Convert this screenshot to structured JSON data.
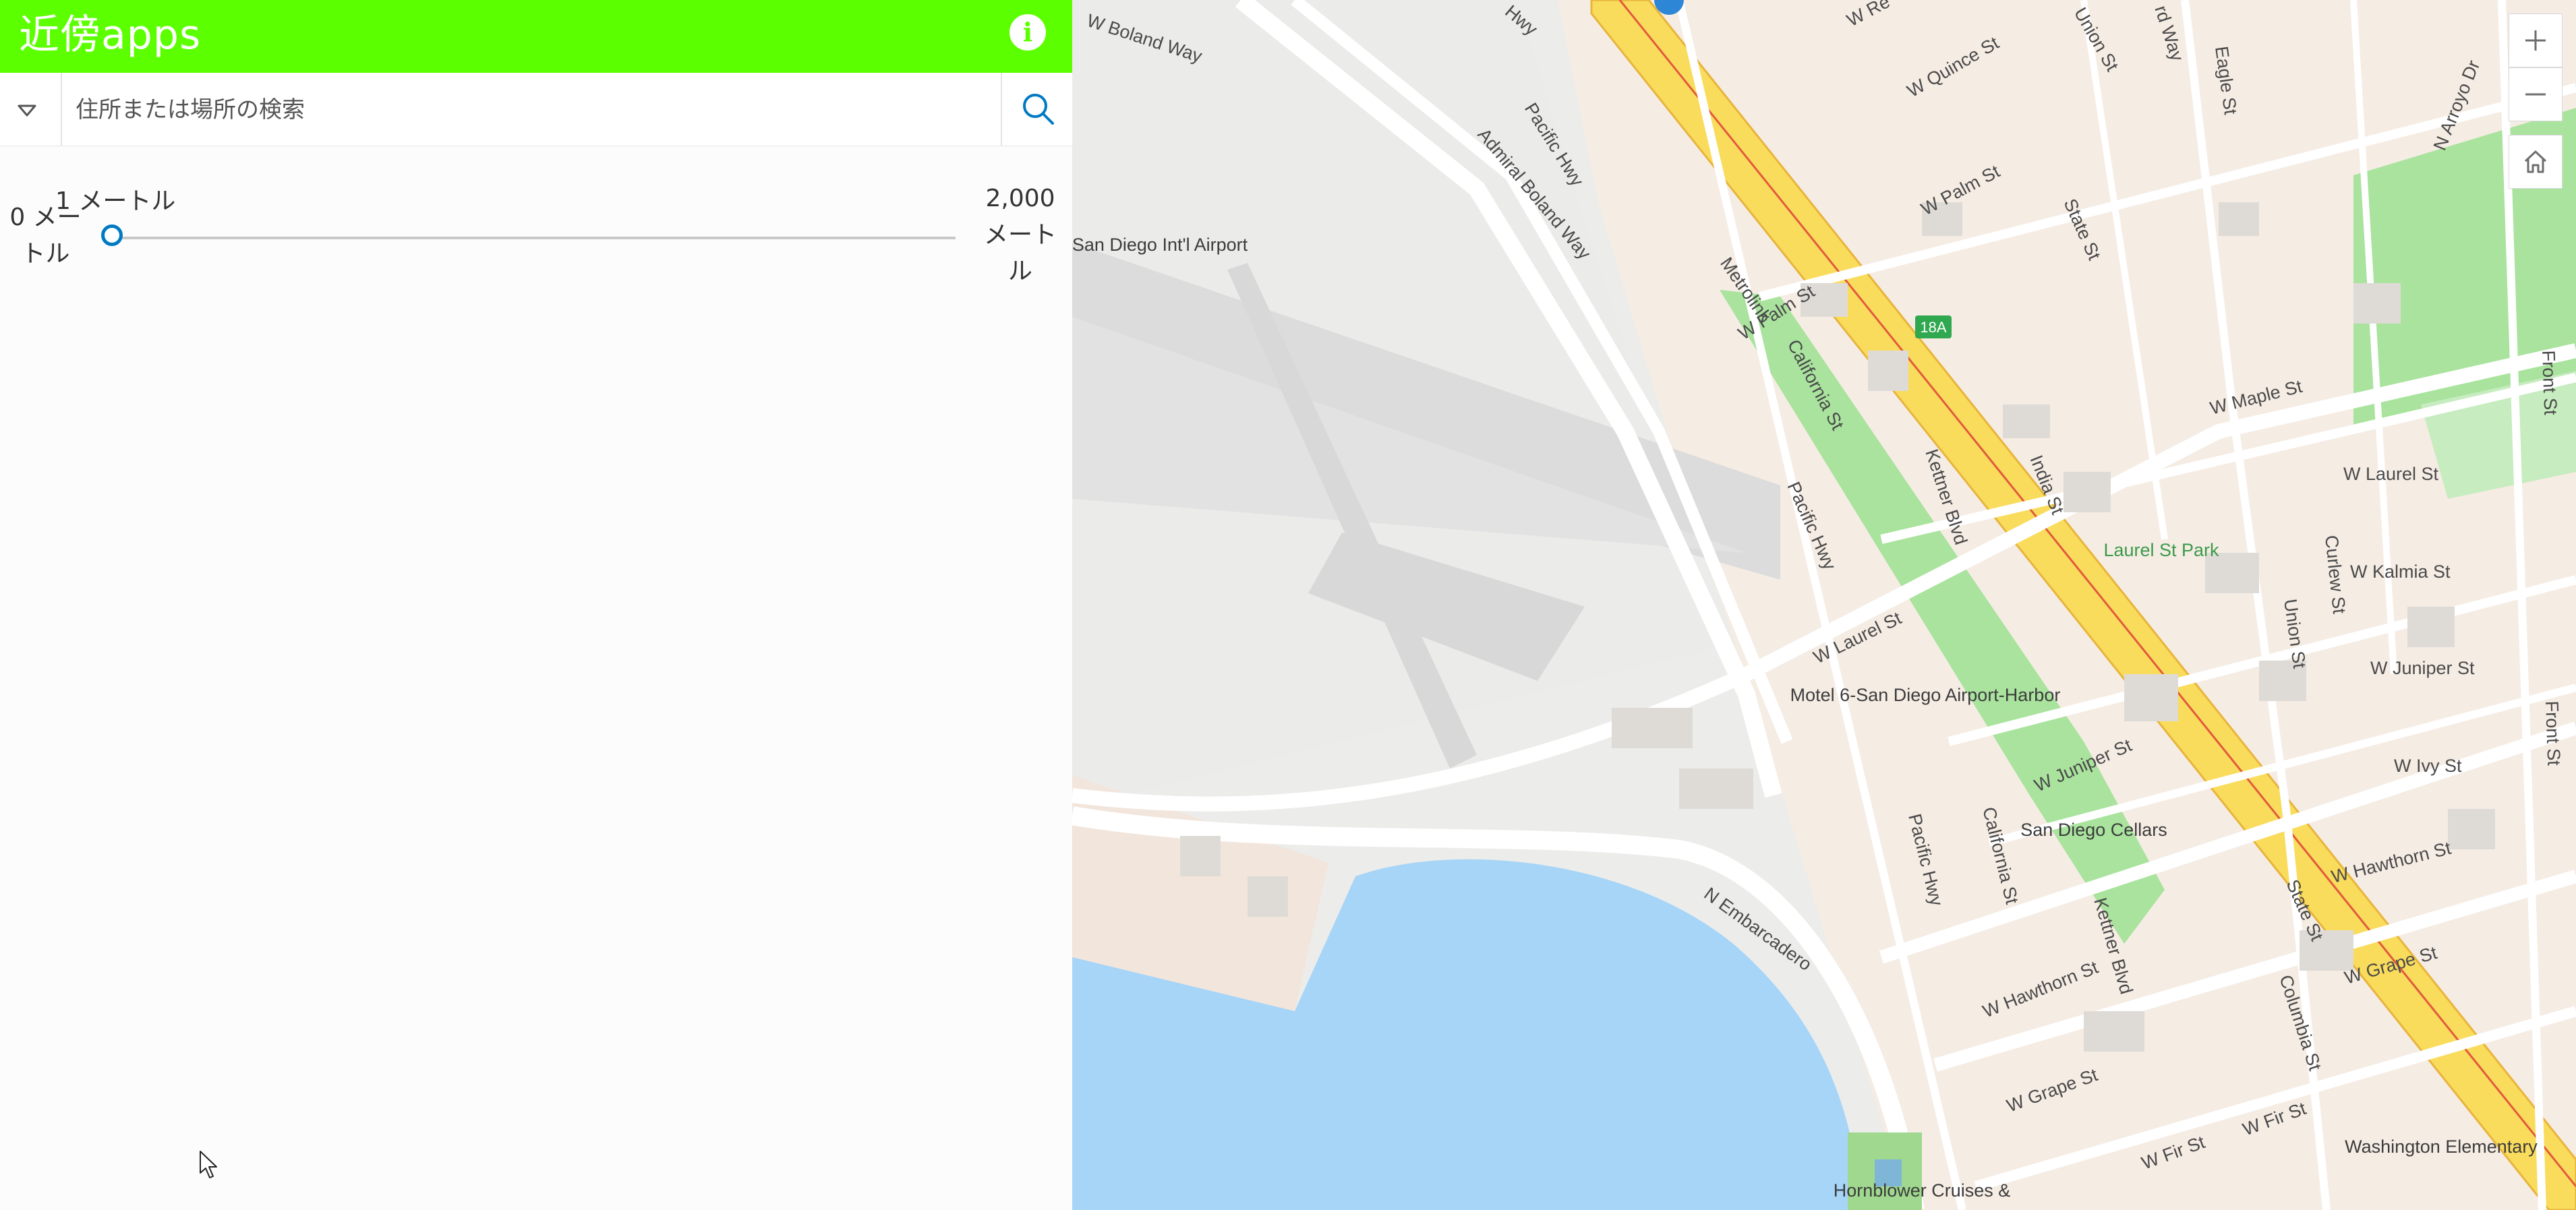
{
  "header": {
    "title": "近傍apps",
    "info_icon": "info-icon",
    "color": "#5cff00"
  },
  "search": {
    "placeholder": "住所または場所の検索",
    "toggle_icon": "triangle-down-icon",
    "search_icon": "search-icon"
  },
  "slider": {
    "min_label": "0 メートル",
    "current_label": "1 メートル",
    "max_label": "2,000 メートル",
    "min": 0,
    "max": 2000,
    "value": 1,
    "accent": "#007ac2"
  },
  "map": {
    "controls": {
      "zoom_in_icon": "plus-icon",
      "zoom_out_icon": "minus-icon",
      "home_icon": "home-icon"
    },
    "highway_shield": "18A",
    "places": {
      "airport": "San Diego Int'l Airport",
      "park": "Laurel St Park",
      "motel": "Motel 6-San Diego Airport-Harbor",
      "cellars": "San Diego Cellars",
      "school": "Washington Elementary",
      "hornblower": "Hornblower Cruises &",
      "metrolink": "Metrolink"
    },
    "streets": {
      "boland": "W Boland Way",
      "pacific1": "Pacific Hwy",
      "admiral": "Admiral Boland Way",
      "pacific_hwy_top": "Hwy",
      "pacific2": "Pacific Hwy",
      "pacific3": "Pacific Hwy",
      "w_palm_left": "W Palm St",
      "california1": "California St",
      "kettner1": "Kettner Blvd",
      "india": "India St",
      "w_laurel_left": "W Laurel St",
      "n_embarcadero": "N Embarcadero",
      "w_juniper_mid": "W Juniper St",
      "california2": "California St",
      "kettner2": "Kettner Blvd",
      "w_hawthorn_mid": "W Hawthorn St",
      "w_grape_mid": "W Grape St",
      "w_fir_1": "W Fir St",
      "w_fir_2": "W Fir St",
      "columbia": "Columbia St",
      "state1": "State St",
      "state2": "State St",
      "w_grape_right": "W Grape St",
      "w_hawthorn_right": "W Hawthorn St",
      "w_ivy": "W Ivy St",
      "w_juniper_right": "W Juniper St",
      "w_kalmia": "W Kalmia St",
      "w_laurel_right": "W Laurel St",
      "w_maple": "W Maple St",
      "union1": "Union St",
      "union2": "Union St",
      "curlew": "Curlew St",
      "front1": "Front St",
      "front2": "Front St",
      "w_palm_right": "W Palm St",
      "w_quince": "W Quince St",
      "eagle": "Eagle St",
      "n_arroyo": "N Arroyo Dr",
      "w_re": "W Re",
      "rd_way": "rd Way"
    }
  }
}
